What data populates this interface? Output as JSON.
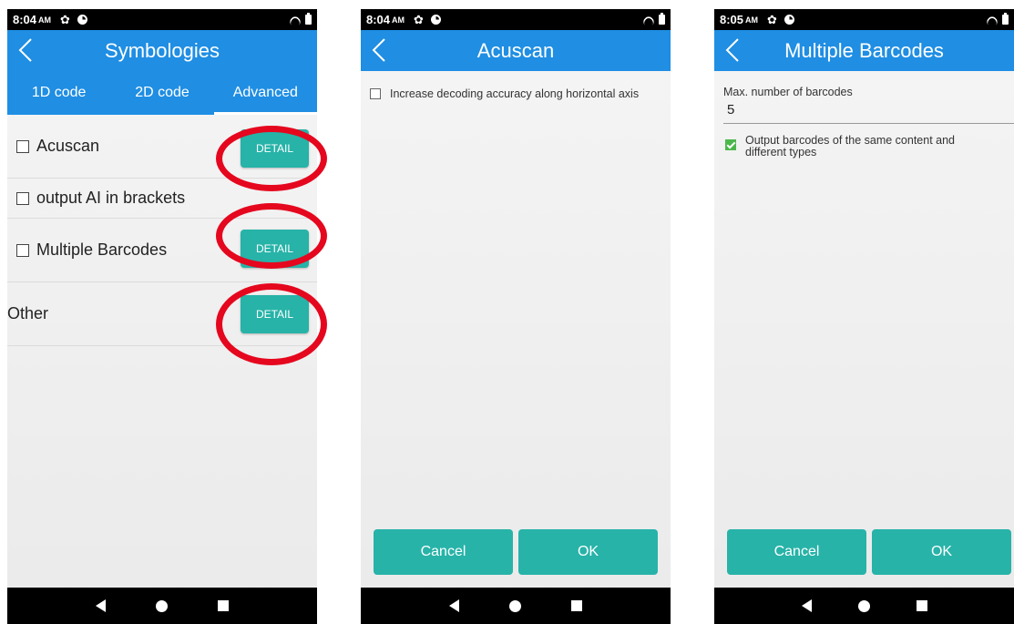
{
  "colors": {
    "appbar": "#1f8ee3",
    "button": "#27b3a8",
    "highlight_ring": "#e5071e",
    "checked": "#4cb84c"
  },
  "status": {
    "time1": "8:04",
    "time2": "8:04",
    "time3": "8:05",
    "ampm": "AM"
  },
  "screen1": {
    "title": "Symbologies",
    "tabs": [
      "1D code",
      "2D code",
      "Advanced"
    ],
    "rows": [
      {
        "label": "Acuscan",
        "has_checkbox": true,
        "detail": "DETAIL"
      },
      {
        "label": "output AI in brackets",
        "has_checkbox": true
      },
      {
        "label": "Multiple Barcodes",
        "has_checkbox": true,
        "detail": "DETAIL"
      },
      {
        "label": "Other",
        "has_checkbox": false,
        "detail": "DETAIL"
      }
    ]
  },
  "screen2": {
    "title": "Acuscan",
    "option": "Increase decoding accuracy along horizontal axis",
    "cancel": "Cancel",
    "ok": "OK"
  },
  "screen3": {
    "title": "Multiple Barcodes",
    "field_label": "Max. number of barcodes",
    "field_value": "5",
    "option_line1": "Output barcodes of the same content and",
    "option_line2": "different types",
    "cancel": "Cancel",
    "ok": "OK"
  }
}
